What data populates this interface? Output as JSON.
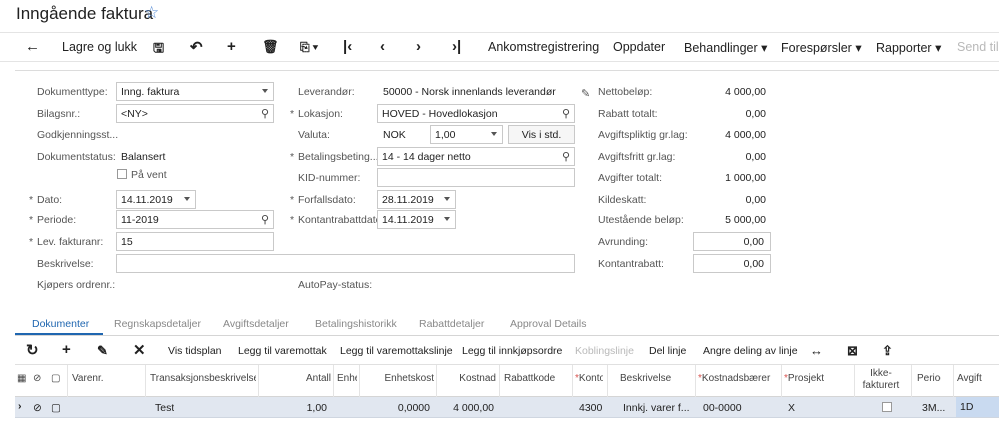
{
  "page": {
    "title": "Inngående faktura"
  },
  "toolbar": {
    "back_icon": "arrow-left-icon",
    "save_close": "Lagre og lukk",
    "items": {
      "ankomst": "Ankomstregistrering",
      "oppdater": "Oppdater",
      "behandlinger": "Behandlinger",
      "foresporsler": "Forespørsler",
      "rapporter": "Rapporter",
      "send": "Send til"
    }
  },
  "form": {
    "dokumenttype": {
      "label": "Dokumenttype:",
      "value": "Inng. faktura"
    },
    "bilagsnr": {
      "label": "Bilagsnr.:",
      "value": "<NY>"
    },
    "godkjenning": {
      "label": "Godkjenningsst..."
    },
    "dokumentstatus": {
      "label": "Dokumentstatus:",
      "value": "Balansert"
    },
    "paa_vent": {
      "label": "På vent"
    },
    "dato": {
      "label": "Dato:",
      "value": "14.11.2019"
    },
    "periode": {
      "label": "Periode:",
      "value": "11-2019"
    },
    "lev_fakturanr": {
      "label": "Lev. fakturanr:",
      "value": "15"
    },
    "beskrivelse": {
      "label": "Beskrivelse:",
      "value": ""
    },
    "kjopers_ordrenr": {
      "label": "Kjøpers ordrenr.:"
    },
    "leverandor": {
      "label": "Leverandør:",
      "value": "50000 - Norsk innenlands leverandør"
    },
    "lokasjon": {
      "label": "Lokasjon:",
      "value": "HOVED - Hovedlokasjon"
    },
    "valuta": {
      "label": "Valuta:",
      "value": "NOK",
      "rate": "1,00",
      "button": "Vis i std."
    },
    "betalingsbet": {
      "label": "Betalingsbeting...",
      "value": "14 - 14 dager netto"
    },
    "kid": {
      "label": "KID-nummer:",
      "value": ""
    },
    "forfallsdato": {
      "label": "Forfallsdato:",
      "value": "28.11.2019"
    },
    "kontantrabattdato": {
      "label": "Kontantrabattdato:",
      "value": "14.11.2019"
    },
    "autopay": {
      "label": "AutoPay-status:"
    }
  },
  "totals": [
    {
      "label": "Nettobeløp:",
      "value": "4 000,00"
    },
    {
      "label": "Rabatt totalt:",
      "value": "0,00"
    },
    {
      "label": "Avgiftspliktig gr.lag:",
      "value": "4 000,00"
    },
    {
      "label": "Avgiftsfritt gr.lag:",
      "value": "0,00"
    },
    {
      "label": "Avgifter totalt:",
      "value": "1 000,00"
    },
    {
      "label": "Kildeskatt:",
      "value": "0,00"
    },
    {
      "label": "Utestående beløp:",
      "value": "5 000,00"
    },
    {
      "label": "Avrunding:",
      "value": "0,00"
    },
    {
      "label": "Kontantrabatt:",
      "value": "0,00"
    }
  ],
  "tabs": [
    "Dokumenter",
    "Regnskapsdetaljer",
    "Avgiftsdetaljer",
    "Betalingshistorikk",
    "Rabattdetaljer",
    "Approval Details"
  ],
  "grid_toolbar": {
    "vis_tidsplan": "Vis tidsplan",
    "legg_varemottak": "Legg til varemottak",
    "legg_varemottakslinje": "Legg til varemottakslinje",
    "legg_innkjop": "Legg til innkjøpsordre",
    "koblingslinje": "Koblingslinje",
    "del_linje": "Del linje",
    "angre_deling": "Angre deling av linje"
  },
  "columns": {
    "varenr": "Varenr.",
    "transbeskr": "Transaksjonsbeskrivelse",
    "antall": "Antall",
    "enhet": "Enhet",
    "enhetskost": "Enhetskost",
    "kostnad": "Kostnad",
    "rabattkode": "Rabattkode",
    "konto": "Konto",
    "beskrivelse": "Beskrivelse",
    "kostnadsbaerer": "Kostnadsbærer",
    "prosjekt": "Prosjekt",
    "ikke_fakt": "Ikke-fakturert",
    "periode": "Periode",
    "avgift": "Avgift"
  },
  "row": {
    "transbeskr": "Test",
    "antall": "1,00",
    "enhetskost": "0,0000",
    "kostnad": "4 000,00",
    "konto": "4300",
    "beskrivelse": "Innkj. varer f...",
    "kostnadsbaerer": "00-0000",
    "prosjekt": "X",
    "periode": "3M...",
    "avgift": "1D"
  }
}
